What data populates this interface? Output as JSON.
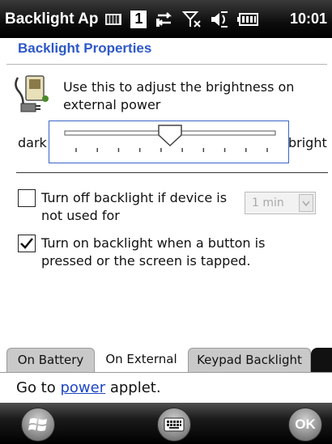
{
  "status_bar": {
    "app_title": "Backlight Ap",
    "sim_slot": "1",
    "time": "10:01",
    "icons": [
      "battery-level-icon",
      "sim-slot-icon",
      "data-connection-icon",
      "no-signal-icon",
      "speaker-icon",
      "battery-icon"
    ]
  },
  "page": {
    "title": "Backlight Properties",
    "description": "Use this to adjust the brightness on external power"
  },
  "brightness": {
    "min_label": "dark",
    "max_label": "bright",
    "tick_count": 10,
    "value_fraction": 0.5
  },
  "options": {
    "turn_off": {
      "label": "Turn off backlight if device is not used for",
      "checked": false,
      "timeout_value": "1 min"
    },
    "turn_on": {
      "label": "Turn on backlight when a button is pressed or the screen is tapped.",
      "checked": true
    }
  },
  "tabs": [
    {
      "label": "On Battery",
      "active": false
    },
    {
      "label": "On External",
      "active": true
    },
    {
      "label": "Keypad Backlight",
      "active": false
    }
  ],
  "footer": {
    "prefix": "Go to ",
    "link": "power",
    "suffix": " applet."
  },
  "bottom_bar": {
    "ok_label": "OK"
  },
  "colors": {
    "title_blue": "#2d58c8",
    "link_blue": "#1e46c8",
    "slider_border": "#3a65c8"
  }
}
